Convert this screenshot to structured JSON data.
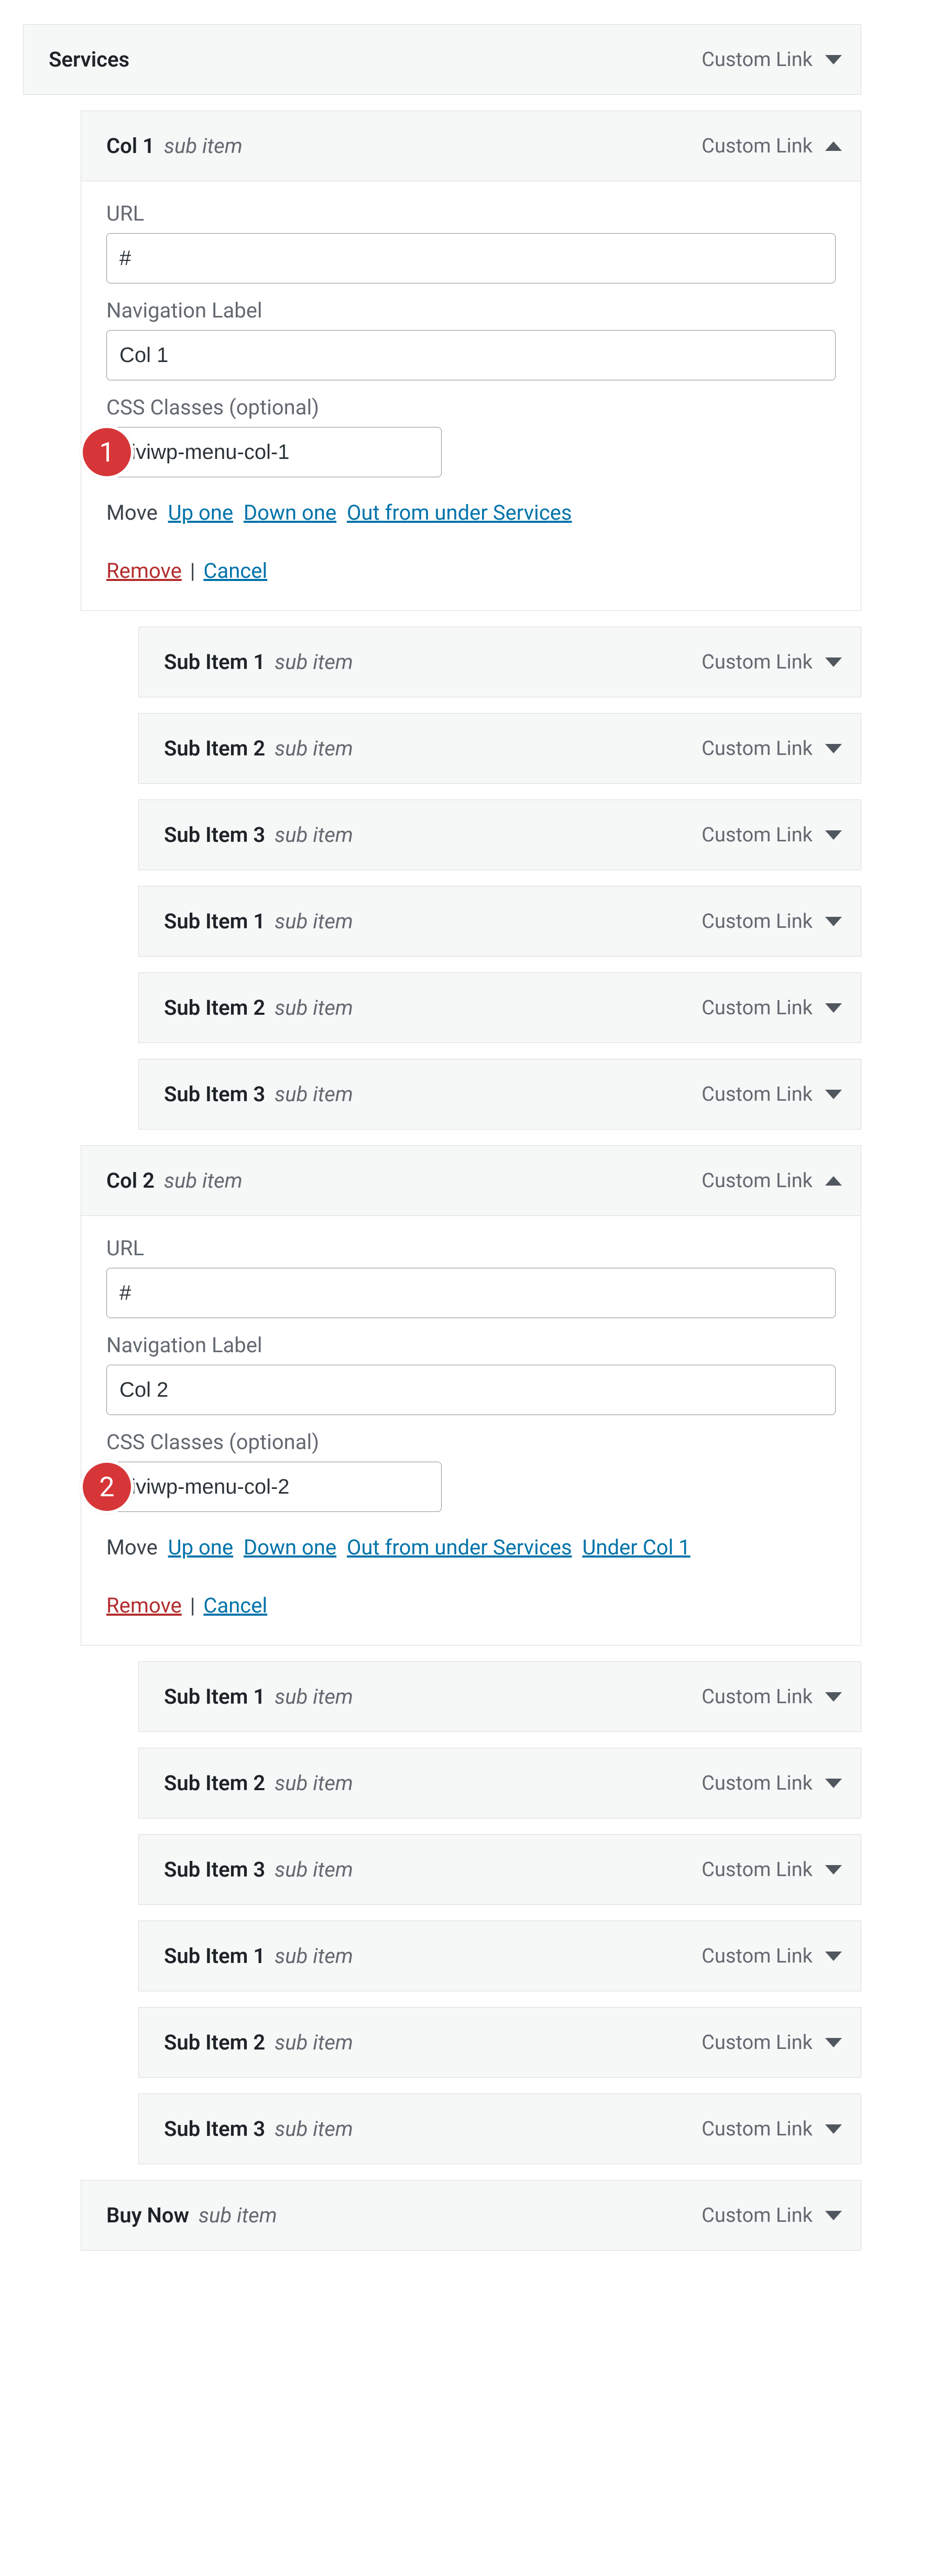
{
  "labels": {
    "url": "URL",
    "nav_label": "Navigation Label",
    "css_classes": "CSS Classes (optional)",
    "move": "Move",
    "up_one": "Up one",
    "down_one": "Down one",
    "out_from_under_services": "Out from under Services",
    "under_col1": "Under Col 1",
    "remove": "Remove",
    "cancel": "Cancel",
    "sub_item": "sub item",
    "custom_link": "Custom Link"
  },
  "badges": {
    "one": "1",
    "two": "2"
  },
  "items": [
    {
      "indent": 0,
      "name": "Services",
      "subtype": "",
      "expanded": false
    },
    {
      "indent": 1,
      "name": "Col 1",
      "subtype": "sub item",
      "expanded": true,
      "body": {
        "url": "#",
        "nav_label": "Col 1",
        "css_classes": "diviwp-menu-col-1",
        "move_links": [
          "up_one",
          "down_one",
          "out_from_under_services"
        ]
      },
      "badge": "one"
    },
    {
      "indent": 2,
      "name": "Sub Item 1",
      "subtype": "sub item",
      "expanded": false
    },
    {
      "indent": 2,
      "name": "Sub Item 2",
      "subtype": "sub item",
      "expanded": false
    },
    {
      "indent": 2,
      "name": "Sub Item 3",
      "subtype": "sub item",
      "expanded": false
    },
    {
      "indent": 2,
      "name": "Sub Item 1",
      "subtype": "sub item",
      "expanded": false
    },
    {
      "indent": 2,
      "name": "Sub Item 2",
      "subtype": "sub item",
      "expanded": false
    },
    {
      "indent": 2,
      "name": "Sub Item 3",
      "subtype": "sub item",
      "expanded": false
    },
    {
      "indent": 1,
      "name": "Col 2",
      "subtype": "sub item",
      "expanded": true,
      "body": {
        "url": "#",
        "nav_label": "Col 2",
        "css_classes": "diviwp-menu-col-2",
        "move_links": [
          "up_one",
          "down_one",
          "out_from_under_services",
          "under_col1"
        ]
      },
      "badge": "two"
    },
    {
      "indent": 2,
      "name": "Sub Item 1",
      "subtype": "sub item",
      "expanded": false
    },
    {
      "indent": 2,
      "name": "Sub Item 2",
      "subtype": "sub item",
      "expanded": false
    },
    {
      "indent": 2,
      "name": "Sub Item 3",
      "subtype": "sub item",
      "expanded": false
    },
    {
      "indent": 2,
      "name": "Sub Item 1",
      "subtype": "sub item",
      "expanded": false
    },
    {
      "indent": 2,
      "name": "Sub Item 2",
      "subtype": "sub item",
      "expanded": false
    },
    {
      "indent": 2,
      "name": "Sub Item 3",
      "subtype": "sub item",
      "expanded": false
    },
    {
      "indent": 1,
      "name": "Buy Now",
      "subtype": "sub item",
      "expanded": false
    }
  ]
}
